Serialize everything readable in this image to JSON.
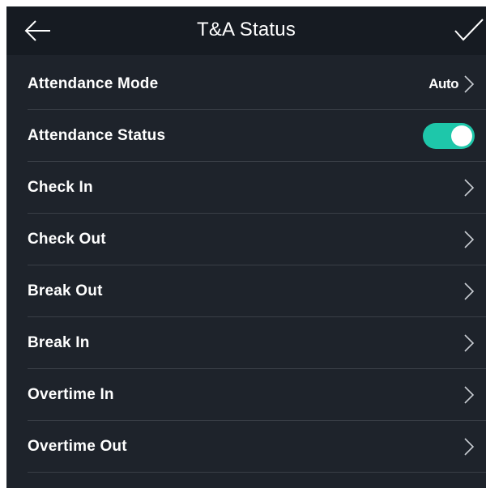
{
  "header": {
    "title": "T&A Status",
    "back_icon": "arrow-left-icon",
    "confirm_icon": "check-icon"
  },
  "rows": [
    {
      "label": "Attendance Mode",
      "value": "Auto",
      "control": "chevron"
    },
    {
      "label": "Attendance Status",
      "control": "toggle",
      "toggle_on": true
    },
    {
      "label": "Check In",
      "control": "chevron"
    },
    {
      "label": "Check Out",
      "control": "chevron"
    },
    {
      "label": "Break Out",
      "control": "chevron"
    },
    {
      "label": "Break In",
      "control": "chevron"
    },
    {
      "label": "Overtime In",
      "control": "chevron"
    },
    {
      "label": "Overtime Out",
      "control": "chevron"
    }
  ],
  "colors": {
    "background": "#1e232b",
    "header_background": "#161b22",
    "divider": "#3a3f47",
    "toggle_on": "#1ec7aa",
    "text": "#ffffff",
    "chevron": "#c8ccd2"
  }
}
